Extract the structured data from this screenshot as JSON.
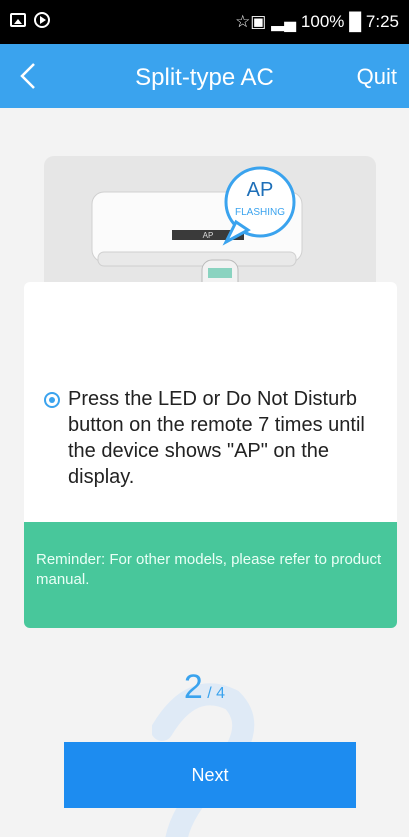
{
  "status_bar": {
    "icons_left": [
      "picture-icon",
      "play-circle-icon"
    ],
    "right_text": "☆▣ ▂▄ 100% █ 7:25"
  },
  "nav": {
    "back_icon": "chevron-left-icon",
    "title": "Split-type AC",
    "quit_label": "Quit"
  },
  "illustration": {
    "bubble_main": "AP",
    "bubble_sub": "FLASHING",
    "display_text": "AP"
  },
  "instruction": "Press the LED or Do Not Disturb button on the remote 7 times until the device shows \"AP\" on the display.",
  "reminder": "Reminder: For other models, please refer to product manual.",
  "step": {
    "current": "2",
    "total": "/ 4"
  },
  "next_label": "Next",
  "colors": {
    "accent": "#3aa3ee",
    "button": "#1d8cf0",
    "reminder_bg": "#48c79b"
  }
}
